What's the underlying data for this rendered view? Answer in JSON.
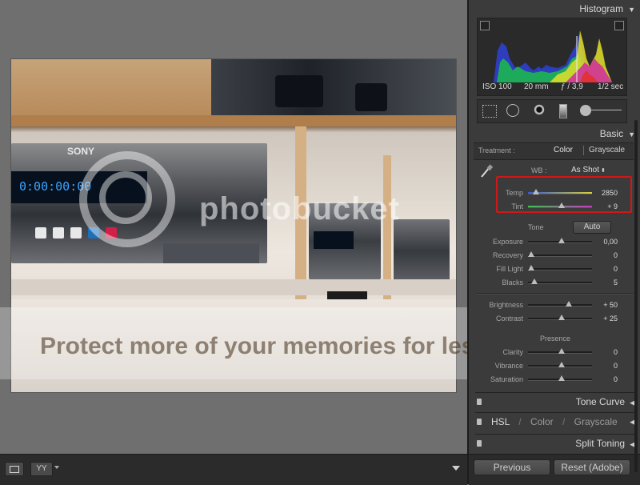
{
  "histogram": {
    "title": "Histogram",
    "iso": "ISO 100",
    "focal": "20 mm",
    "aperture": "ƒ / 3,9",
    "shutter": "1/2 sec"
  },
  "basic": {
    "title": "Basic",
    "treatment_label": "Treatment :",
    "color_label": "Color",
    "grayscale_label": "Grayscale",
    "wb_label": "WB :",
    "wb_value": "As Shot",
    "temp_label": "Temp",
    "temp_value": "2850",
    "temp_level": 0.18,
    "tint_label": "Tint",
    "tint_value": "+ 9",
    "tint_level": 0.55,
    "tone_label": "Tone",
    "auto_label": "Auto",
    "sliders": [
      {
        "label": "Exposure",
        "value": "0,00",
        "level": 0.5
      },
      {
        "label": "Recovery",
        "value": "0",
        "level": 0.0
      },
      {
        "label": "Fill Light",
        "value": "0",
        "level": 0.0
      },
      {
        "label": "Blacks",
        "value": "5",
        "level": 0.05
      }
    ],
    "sliders2": [
      {
        "label": "Brightness",
        "value": "+ 50",
        "level": 0.62
      },
      {
        "label": "Contrast",
        "value": "+ 25",
        "level": 0.5
      }
    ],
    "presence_label": "Presence",
    "sliders3": [
      {
        "label": "Clarity",
        "value": "0",
        "level": 0.5
      },
      {
        "label": "Vibrance",
        "value": "0",
        "level": 0.5
      },
      {
        "label": "Saturation",
        "value": "0",
        "level": 0.5
      }
    ]
  },
  "panels": {
    "tone_curve": "Tone Curve",
    "hsl": "HSL",
    "slash": "/",
    "color": "Color",
    "grayscale": "Grayscale",
    "split_toning": "Split Toning"
  },
  "buttons": {
    "previous": "Previous",
    "reset": "Reset (Adobe)"
  },
  "watermark": {
    "brand": "photobucket",
    "banner": "Protect more of your memories for less!"
  },
  "photo": {
    "brand_label": "SONY",
    "counter_text": "0:00:00:00"
  },
  "colors": {
    "accent_red": "#d01818",
    "panel_bg": "#3b3b3b"
  }
}
